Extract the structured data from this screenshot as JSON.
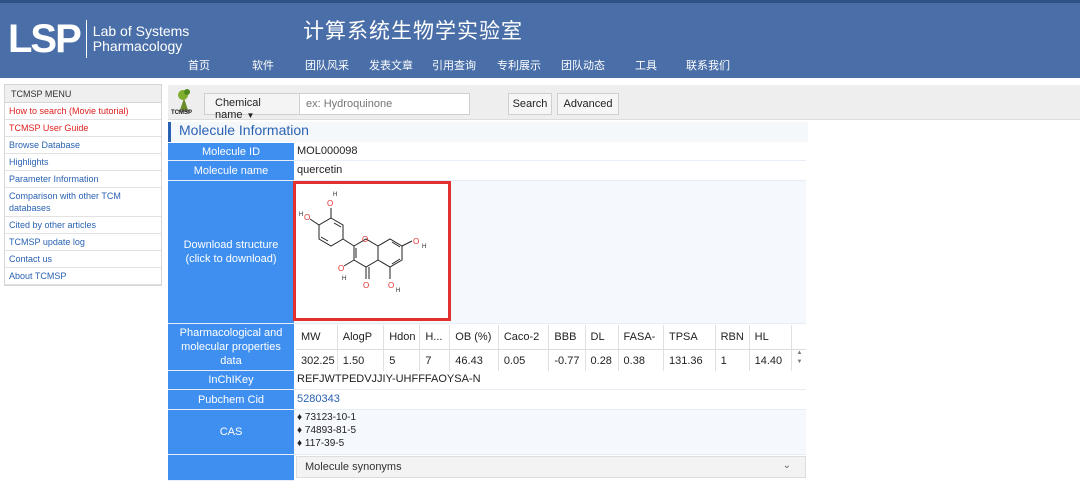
{
  "header": {
    "logo_mark": "LSP",
    "logo_line1": "Lab of Systems",
    "logo_line2": "Pharmacology",
    "site_title": "计算系统生物学实验室",
    "nav": [
      "首页",
      "软件",
      "团队风采",
      "发表文章",
      "引用查询",
      "专利展示",
      "团队动态",
      "工具",
      "联系我们"
    ]
  },
  "sidebar": {
    "title": "TCMSP MENU",
    "items": [
      {
        "label": "How to search (Movie tutorial)",
        "color": "red"
      },
      {
        "label": "TCMSP User Guide",
        "color": "red"
      },
      {
        "label": "Browse Database",
        "color": "blue"
      },
      {
        "label": "Highlights",
        "color": "blue"
      },
      {
        "label": "Parameter Information",
        "color": "blue"
      },
      {
        "label": "Comparison with other TCM databases",
        "color": "blue"
      },
      {
        "label": "Cited by other articles",
        "color": "blue"
      },
      {
        "label": "TCMSP update log",
        "color": "blue"
      },
      {
        "label": "Contact us",
        "color": "blue"
      },
      {
        "label": "About TCMSP",
        "color": "blue"
      }
    ]
  },
  "search": {
    "icon_label": "TCMSP",
    "dropdown_value": "Chemical name",
    "placeholder": "ex: Hydroquinone",
    "search_label": "Search",
    "advanced_label": "Advanced"
  },
  "molecule": {
    "section_title": "Molecule Information",
    "id_label": "Molecule ID",
    "id_value": "MOL000098",
    "name_label": "Molecule name",
    "name_value": "quercetin",
    "structure_label": "Download structure (click to download)",
    "props_label": "Pharmacological and molecular properties data",
    "inchikey_label": "InChIKey",
    "inchikey_value": "REFJWTPEDVJJIY-UHFFFAOYSA-N",
    "pubchem_label": "Pubchem Cid",
    "pubchem_value": "5280343",
    "cas_label": "CAS",
    "cas_values": [
      "73123-10-1",
      "74893-81-5",
      "117-39-5"
    ],
    "synonyms_label": "Molecule synonyms"
  },
  "properties": {
    "headers": [
      "MW",
      "AlogP",
      "Hdon",
      "H...",
      "OB (%)",
      "Caco-2",
      "BBB",
      "DL",
      "FASA-",
      "TPSA",
      "RBN",
      "HL"
    ],
    "values": [
      "302.25",
      "1.50",
      "5",
      "7",
      "46.43",
      "0.05",
      "-0.77",
      "0.28",
      "0.38",
      "131.36",
      "1",
      "14.40"
    ]
  },
  "colors": {
    "header_bg": "#4a6fa8",
    "label_cell_bg": "#3f8ff0",
    "highlight_frame": "#e03030",
    "link_blue": "#2a62b3",
    "menu_red": "#e02020"
  }
}
